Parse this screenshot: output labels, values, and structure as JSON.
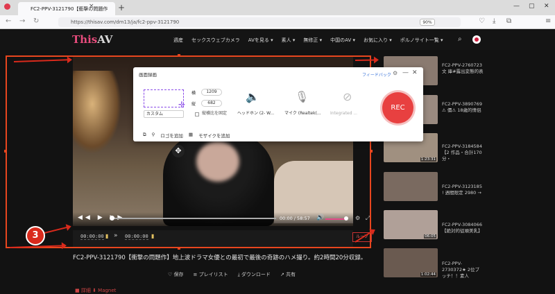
{
  "browser": {
    "tab_title": "FC2-PPV-3121790【衝撃の問題作",
    "tab_close": "×",
    "new_tab": "+",
    "url": "https://thisav.com/dm13/ja/fc2-ppv-3121790",
    "zoom": "90%",
    "win_min": "—",
    "win_max": "▢",
    "win_close": "✕"
  },
  "site": {
    "logo_a": "This",
    "logo_b": "AV",
    "nav": [
      "週産",
      "セックスウェブカメラ",
      "AVを見る ▾",
      "素人 ▾",
      "無修正 ▾",
      "中国のAV ▾",
      "お気に入り ▾",
      "ポルノサイト一覧 ▾"
    ]
  },
  "player": {
    "time": "00:00 / 58:57",
    "controls_icons": "◀◀ ▶ ▶▶",
    "volume_icon": "🔊",
    "clip_start": "00:00:00",
    "clip_end": "00:00:00",
    "clip_arrow": "»",
    "loop_button": "ループ"
  },
  "video": {
    "title": "FC2-PPV-3121790【衝撃の問題作】地上波ドラマ女優との最初で最後の奇跡のハメ撮り。約2時間20分収録。",
    "actions": [
      "♡ 保存",
      "≡ プレイリスト",
      "⤓ ダウンロード",
      "↗ 共有"
    ],
    "below": "■ 詳細     ⬇ Magnet"
  },
  "sidebar": [
    {
      "dur": "",
      "text": "FC2-PPV-2760723 文 庫#露出変態的表"
    },
    {
      "dur": "",
      "text": "FC2-PPV-3890769 ⚠ 價⚠ 18歳的情侶"
    },
    {
      "dur": "1:23:31",
      "text": "FC2-PPV-3184584【2 作品・合計170分・"
    },
    {
      "dur": "",
      "text": "FC2-PPV-3123185 ! 週間限定 2980 →"
    },
    {
      "dur": "06:05",
      "text": "FC2-PPV-3084066 【絶対的従順美乳】"
    },
    {
      "dur": "1:02:44",
      "text": "FC2-PPV-2730372★ 2位ブッチ！！素人"
    }
  ],
  "recorder": {
    "title": "画面録画",
    "feedback": "フィードバック",
    "width_label": "横",
    "width_value": "1209",
    "height_label": "縦",
    "height_value": "682",
    "preset": "カスタム",
    "lock_label": "縦横比を固定",
    "speaker": "ヘッドホン (2- W...",
    "mic": "マイク (Realtek(...",
    "camera": "Integrated ...",
    "rec_label": "REC",
    "tool_logo": "ロゴを追加",
    "tool_mosaic": "モザイクを追加"
  },
  "callout": {
    "number": "3"
  },
  "colors": {
    "accent": "#e8461e",
    "rec": "#e84040",
    "logo_pink": "#e74c7c"
  }
}
